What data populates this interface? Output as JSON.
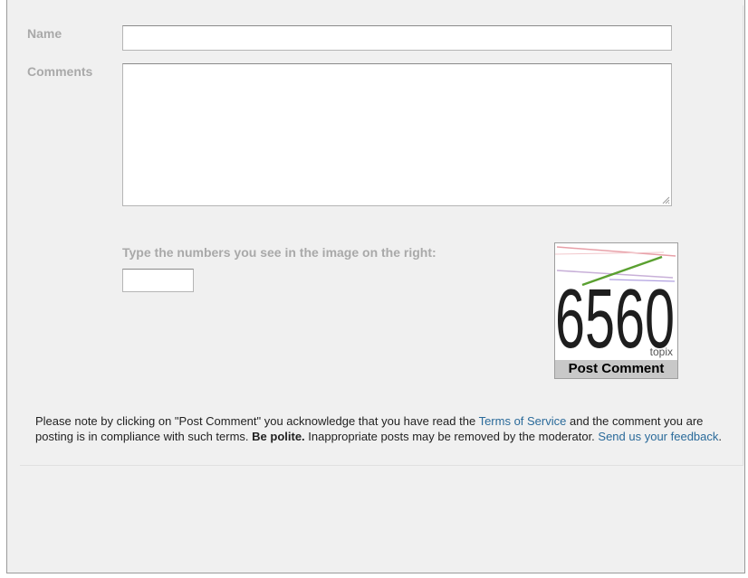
{
  "form": {
    "name_label": "Name",
    "name_value": "",
    "comments_label": "Comments",
    "comments_value": "",
    "captcha_prompt": "Type the numbers you see in the image on the right:",
    "captcha_value": "",
    "captcha_image_text": "6560",
    "captcha_brand": "topix",
    "post_button": "Post Comment"
  },
  "notice": {
    "part1": "Please note by clicking on \"Post Comment\" you acknowledge that you have read the ",
    "tos_link": "Terms of Service",
    "part2": " and the comment you are posting is in compliance with such terms. ",
    "be_polite": "Be polite.",
    "part3": " Inappropriate posts may be removed by the moderator. ",
    "feedback_link": "Send us your feedback",
    "part4": "."
  },
  "colors": {
    "label": "#a9a9a9",
    "link": "#2a6a9a",
    "panel_bg": "#f0f0f0",
    "button_bg": "#c8c8c8"
  }
}
